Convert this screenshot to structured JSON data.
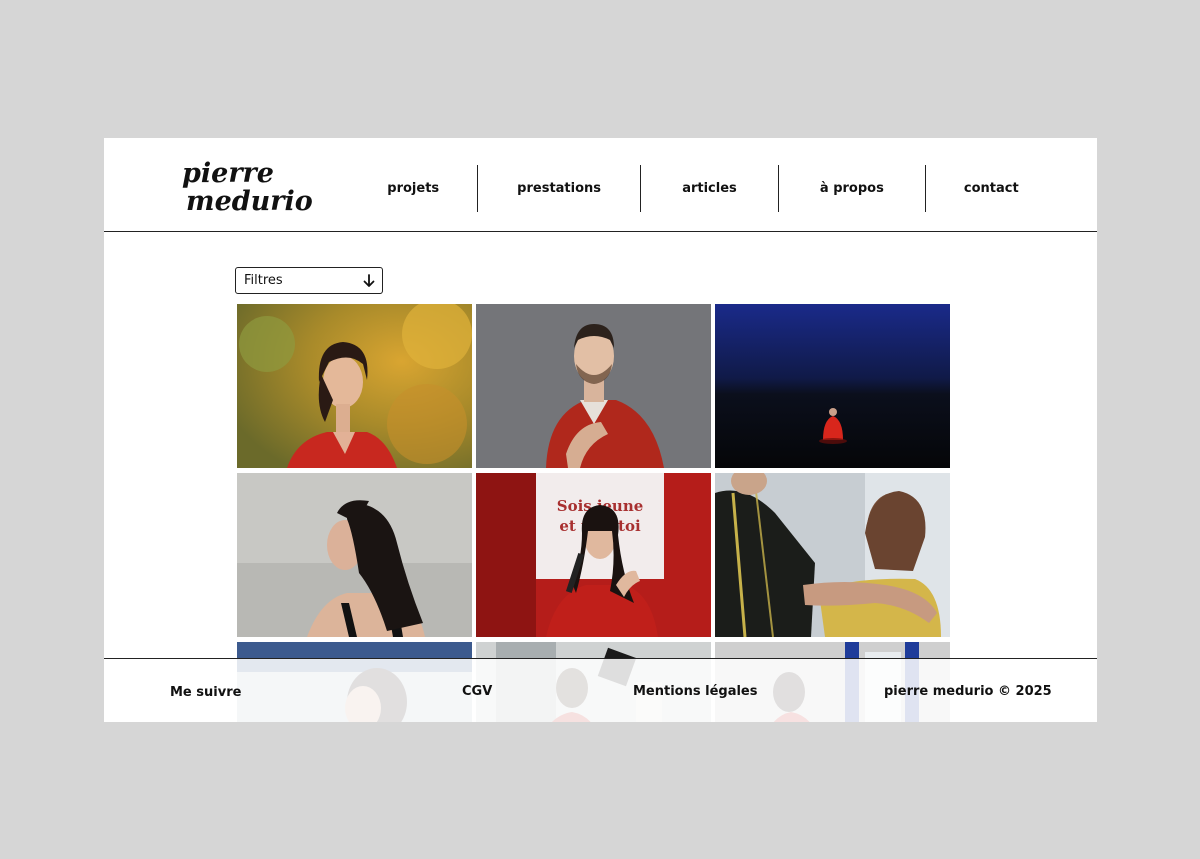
{
  "brand": {
    "logo_line1": "pierre",
    "logo_line2": "medurio"
  },
  "nav": {
    "items": [
      {
        "label": "projets"
      },
      {
        "label": "prestations"
      },
      {
        "label": "articles"
      },
      {
        "label": "à propos"
      },
      {
        "label": "contact"
      }
    ]
  },
  "filters": {
    "label": "Filtres",
    "icon": "arrow-down-icon"
  },
  "gallery": {
    "rows": [
      [
        {
          "subject": "woman-in-red-among-yellow-foliage"
        },
        {
          "subject": "man-with-red-drape"
        },
        {
          "subject": "red-figure-on-dark-stage"
        }
      ],
      [
        {
          "subject": "woman-profile-dark-hair"
        },
        {
          "subject": "woman-speaking-microphone"
        },
        {
          "subject": "hand-on-shoulder"
        }
      ],
      [
        {
          "subject": "partial-portrait-blue"
        },
        {
          "subject": "partial-rehearsal-room"
        },
        {
          "subject": "partial-window-scene"
        }
      ]
    ],
    "poster_text": {
      "line1": "Sois jeune",
      "line2": "et tais-toi"
    }
  },
  "footer": {
    "follow": "Me suivre",
    "cgv": "CGV",
    "legal": "Mentions légales",
    "copyright": "pierre medurio © 2025"
  }
}
